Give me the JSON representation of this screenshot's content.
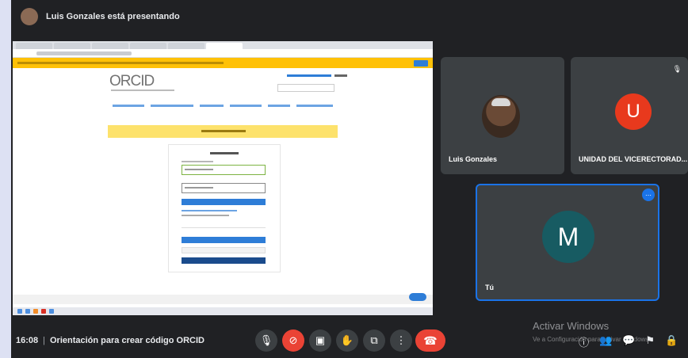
{
  "topbar": {
    "presenting_text": "Luis Gonzales está presentando"
  },
  "participants": [
    {
      "name": "Luis Gonzales"
    },
    {
      "name": "UNIDAD DEL VICERECTORAD...",
      "initial": "U",
      "color": "#e8391d"
    },
    {
      "name": "Tú",
      "initial": "M",
      "color": "#175b62"
    }
  ],
  "shared_screen": {
    "logo_text": "ORCID"
  },
  "meeting": {
    "time": "16:08",
    "title": "Orientación para crear código ORCID"
  },
  "watermark": {
    "title": "Activar Windows",
    "subtitle": "Ve a Configuración para activar Windows."
  },
  "controls": [
    {
      "name": "microphone-icon",
      "glyph": "🎙"
    },
    {
      "name": "camera-off-icon",
      "glyph": "⊘"
    },
    {
      "name": "captions-icon",
      "glyph": "▣"
    },
    {
      "name": "raise-hand-icon",
      "glyph": "✋"
    },
    {
      "name": "present-icon",
      "glyph": "⧉"
    },
    {
      "name": "more-options-icon",
      "glyph": "⋮"
    },
    {
      "name": "hang-up-icon",
      "glyph": "☎"
    }
  ],
  "side_icons": [
    {
      "name": "info-icon",
      "glyph": "ⓘ"
    },
    {
      "name": "people-icon",
      "glyph": "👥"
    },
    {
      "name": "chat-icon",
      "glyph": "💬"
    },
    {
      "name": "activities-icon",
      "glyph": "⚑"
    },
    {
      "name": "host-controls-icon",
      "glyph": "🔒"
    }
  ]
}
